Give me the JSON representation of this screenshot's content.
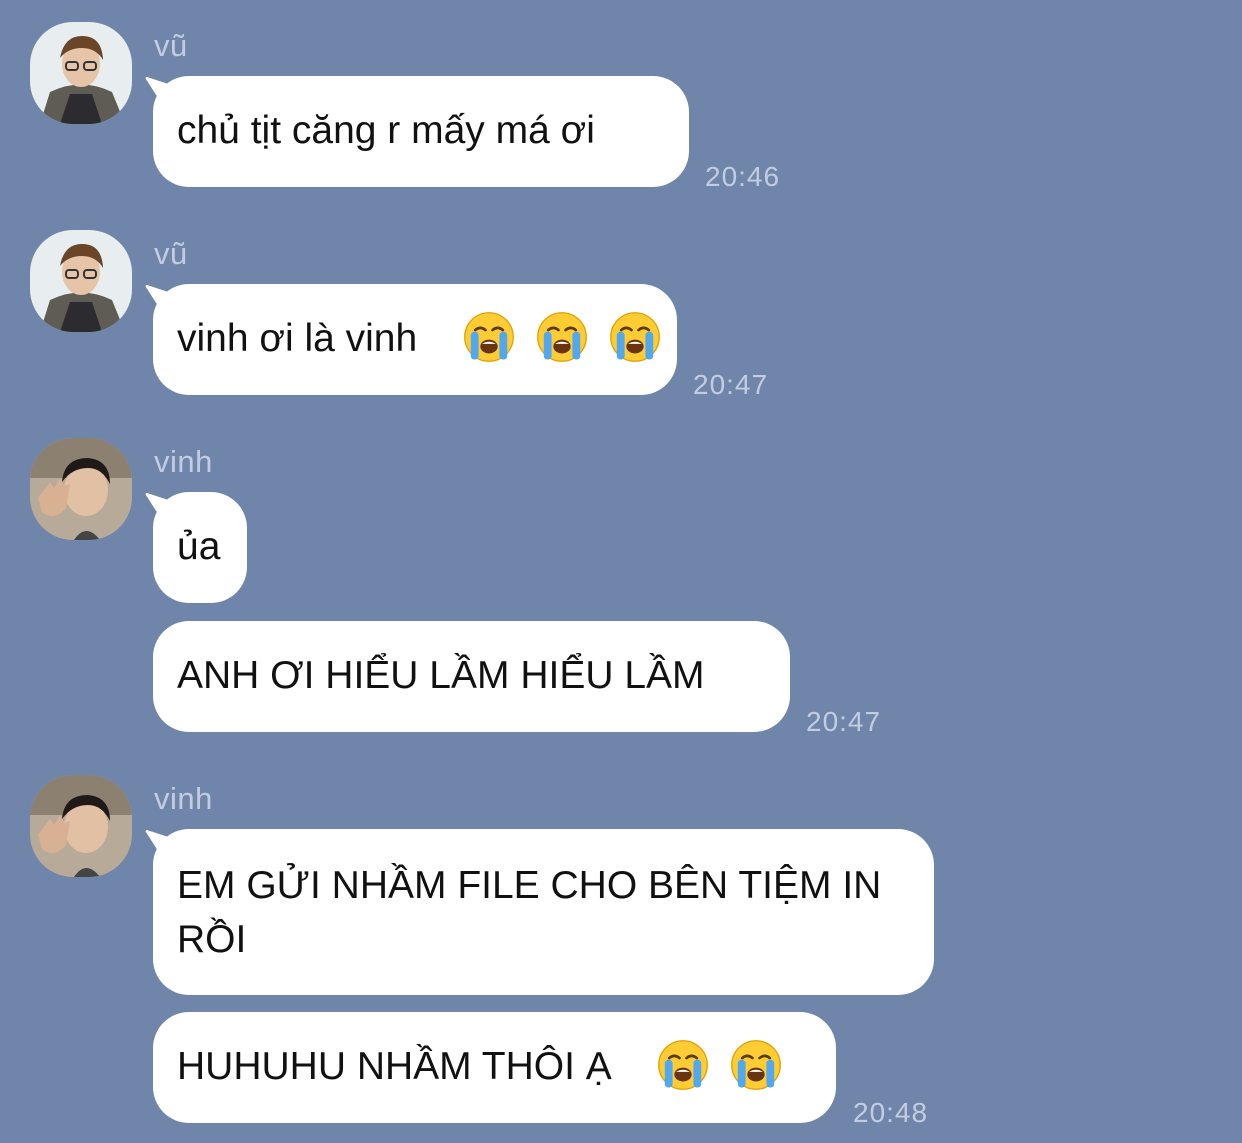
{
  "colors": {
    "background": "#7085aa",
    "bubble": "#ffffff",
    "meta_text": "#c3cde0"
  },
  "messages": [
    {
      "sender": "vũ",
      "avatar": "vu-avatar",
      "bubbles": [
        "chủ tịt căng r mấy má ơi"
      ],
      "time": "20:46"
    },
    {
      "sender": "vũ",
      "avatar": "vu-avatar",
      "bubbles": [
        "vinh ơi là vinh"
      ],
      "emoji": [
        "loudly-crying-face-icon",
        "loudly-crying-face-icon",
        "loudly-crying-face-icon"
      ],
      "time": "20:47"
    },
    {
      "sender": "vinh",
      "avatar": "vinh-avatar",
      "bubbles": [
        "ủa",
        "ANH ƠI HIỂU LẦM HIỂU LẦM"
      ],
      "time": "20:47"
    },
    {
      "sender": "vinh",
      "avatar": "vinh-avatar",
      "bubbles": [
        "EM GỬI NHẦM FILE CHO BÊN TIỆM IN RỒI",
        "HUHUHU NHẦM THÔI Ạ"
      ],
      "emoji": [
        "loudly-crying-face-icon",
        "loudly-crying-face-icon"
      ],
      "time": "20:48"
    }
  ]
}
